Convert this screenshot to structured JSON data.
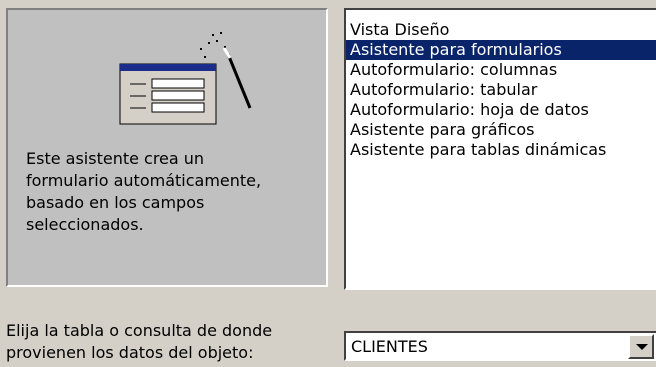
{
  "preview": {
    "icon": "form-wizard-icon",
    "description": "Este asistente crea un\nformulario automáticamente,\nbasado en los campos\nseleccionados."
  },
  "wizard_list": {
    "items": [
      {
        "label": "Vista Diseño"
      },
      {
        "label": "Asistente para formularios",
        "selected": true
      },
      {
        "label": "Autoformulario: columnas"
      },
      {
        "label": "Autoformulario: tabular"
      },
      {
        "label": "Autoformulario: hoja de datos"
      },
      {
        "label": "Asistente para gráficos"
      },
      {
        "label": "Asistente para tablas dinámicas"
      }
    ]
  },
  "source": {
    "prompt": "Elija la tabla o consulta de donde\nprovienen los datos del objeto:",
    "value": "CLIENTES",
    "arrow_icon": "dropdown-arrow-icon"
  },
  "colors": {
    "dialog_bg": "#d4d0c8",
    "selection_bg": "#0a246a",
    "selection_text": "#ffffff"
  }
}
